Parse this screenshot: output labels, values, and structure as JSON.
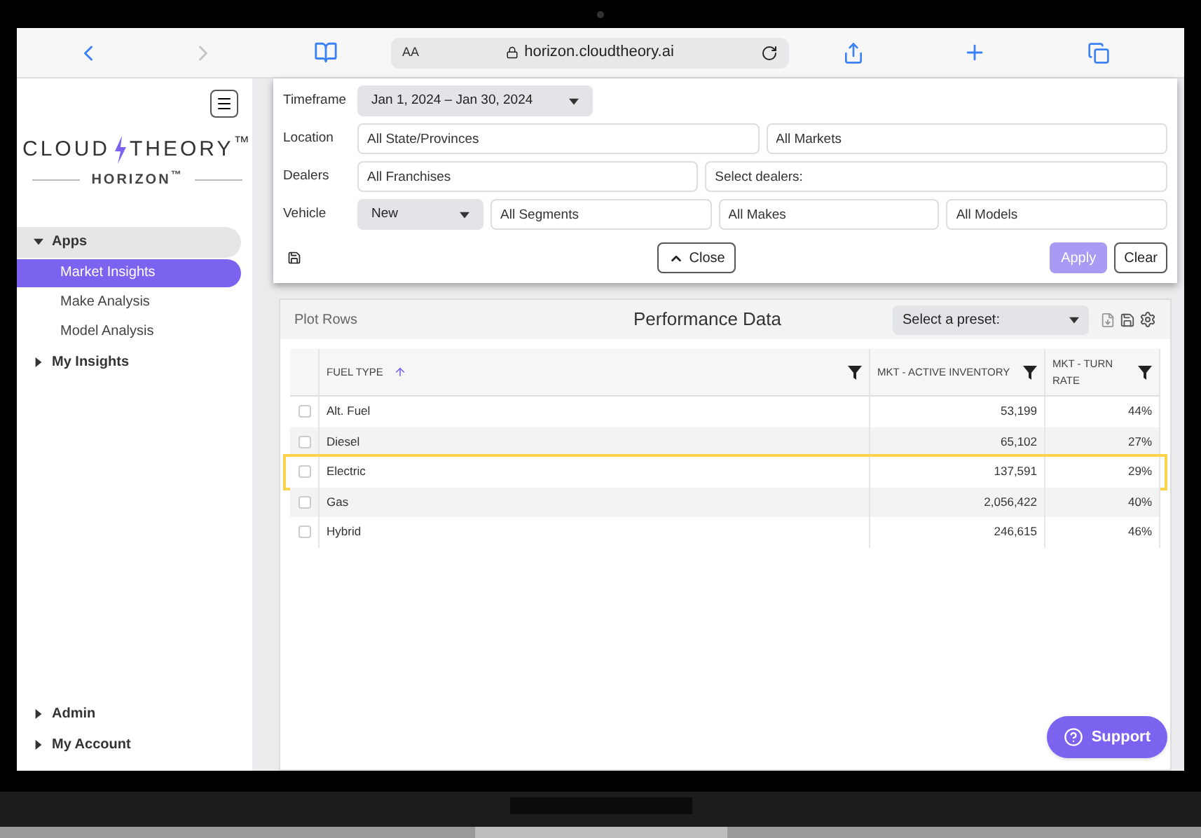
{
  "browser": {
    "text_size": "AA",
    "url": "horizon.cloudtheory.ai"
  },
  "sidebar": {
    "logo": {
      "left": "CLOUD",
      "right": "THEORY$^{™}$",
      "product": "HORIZON$^{™}$"
    },
    "nav": [
      {
        "label": "Apps",
        "expanded": true,
        "children": [
          {
            "label": "Market Insights",
            "selected": true
          },
          {
            "label": "Make Analysis",
            "selected": false
          },
          {
            "label": "Model Analysis",
            "selected": false
          }
        ]
      },
      {
        "label": "My Insights",
        "expanded": false
      }
    ],
    "bottom_nav": [
      {
        "label": "Admin",
        "expanded": false
      },
      {
        "label": "My Account",
        "expanded": false
      }
    ]
  },
  "filters": {
    "rows": [
      {
        "label": "Timeframe",
        "fields": [
          {
            "kind": "select",
            "value": "Jan 1, 2024 – Jan 30, 2024"
          }
        ]
      },
      {
        "label": "Location",
        "fields": [
          {
            "kind": "input",
            "placeholder": "All State/Provinces"
          },
          {
            "kind": "input",
            "placeholder": "All Markets"
          }
        ]
      },
      {
        "label": "Dealers",
        "fields": [
          {
            "kind": "input",
            "placeholder": "All Franchises"
          },
          {
            "kind": "input",
            "placeholder": "Select dealers:"
          }
        ]
      },
      {
        "label": "Vehicle",
        "fields": [
          {
            "kind": "select",
            "value": "New"
          },
          {
            "kind": "input",
            "placeholder": "All Segments"
          },
          {
            "kind": "input",
            "placeholder": "All Makes"
          },
          {
            "kind": "input",
            "placeholder": "All Models"
          }
        ]
      }
    ],
    "close": "Close",
    "apply": {
      "label": "Apply",
      "disabled": true
    },
    "clear": "Clear"
  },
  "table": {
    "left_label": "Plot Rows",
    "title": "Performance Data",
    "preset": {
      "placeholder": "Select a preset:"
    },
    "columns": [
      {
        "label": "FUEL TYPE",
        "sorted": true
      },
      {
        "label": "MKT - ACTIVE INVENTORY",
        "sorted": false
      },
      {
        "label": "MKT - TURN RATE",
        "sorted": false
      }
    ],
    "rows": [
      {
        "checked": false,
        "highlighted": false,
        "cells": [
          "Alt. Fuel",
          "53,199",
          "44%"
        ]
      },
      {
        "checked": false,
        "highlighted": false,
        "cells": [
          "Diesel",
          "65,102",
          "27%"
        ]
      },
      {
        "checked": false,
        "highlighted": true,
        "cells": [
          "Electric",
          "137,591",
          "29%"
        ]
      },
      {
        "checked": false,
        "highlighted": false,
        "cells": [
          "Gas",
          "2,056,422",
          "40%"
        ]
      },
      {
        "checked": false,
        "highlighted": false,
        "cells": [
          "Hybrid",
          "246,615",
          "46%"
        ]
      }
    ]
  },
  "support": "Support"
}
